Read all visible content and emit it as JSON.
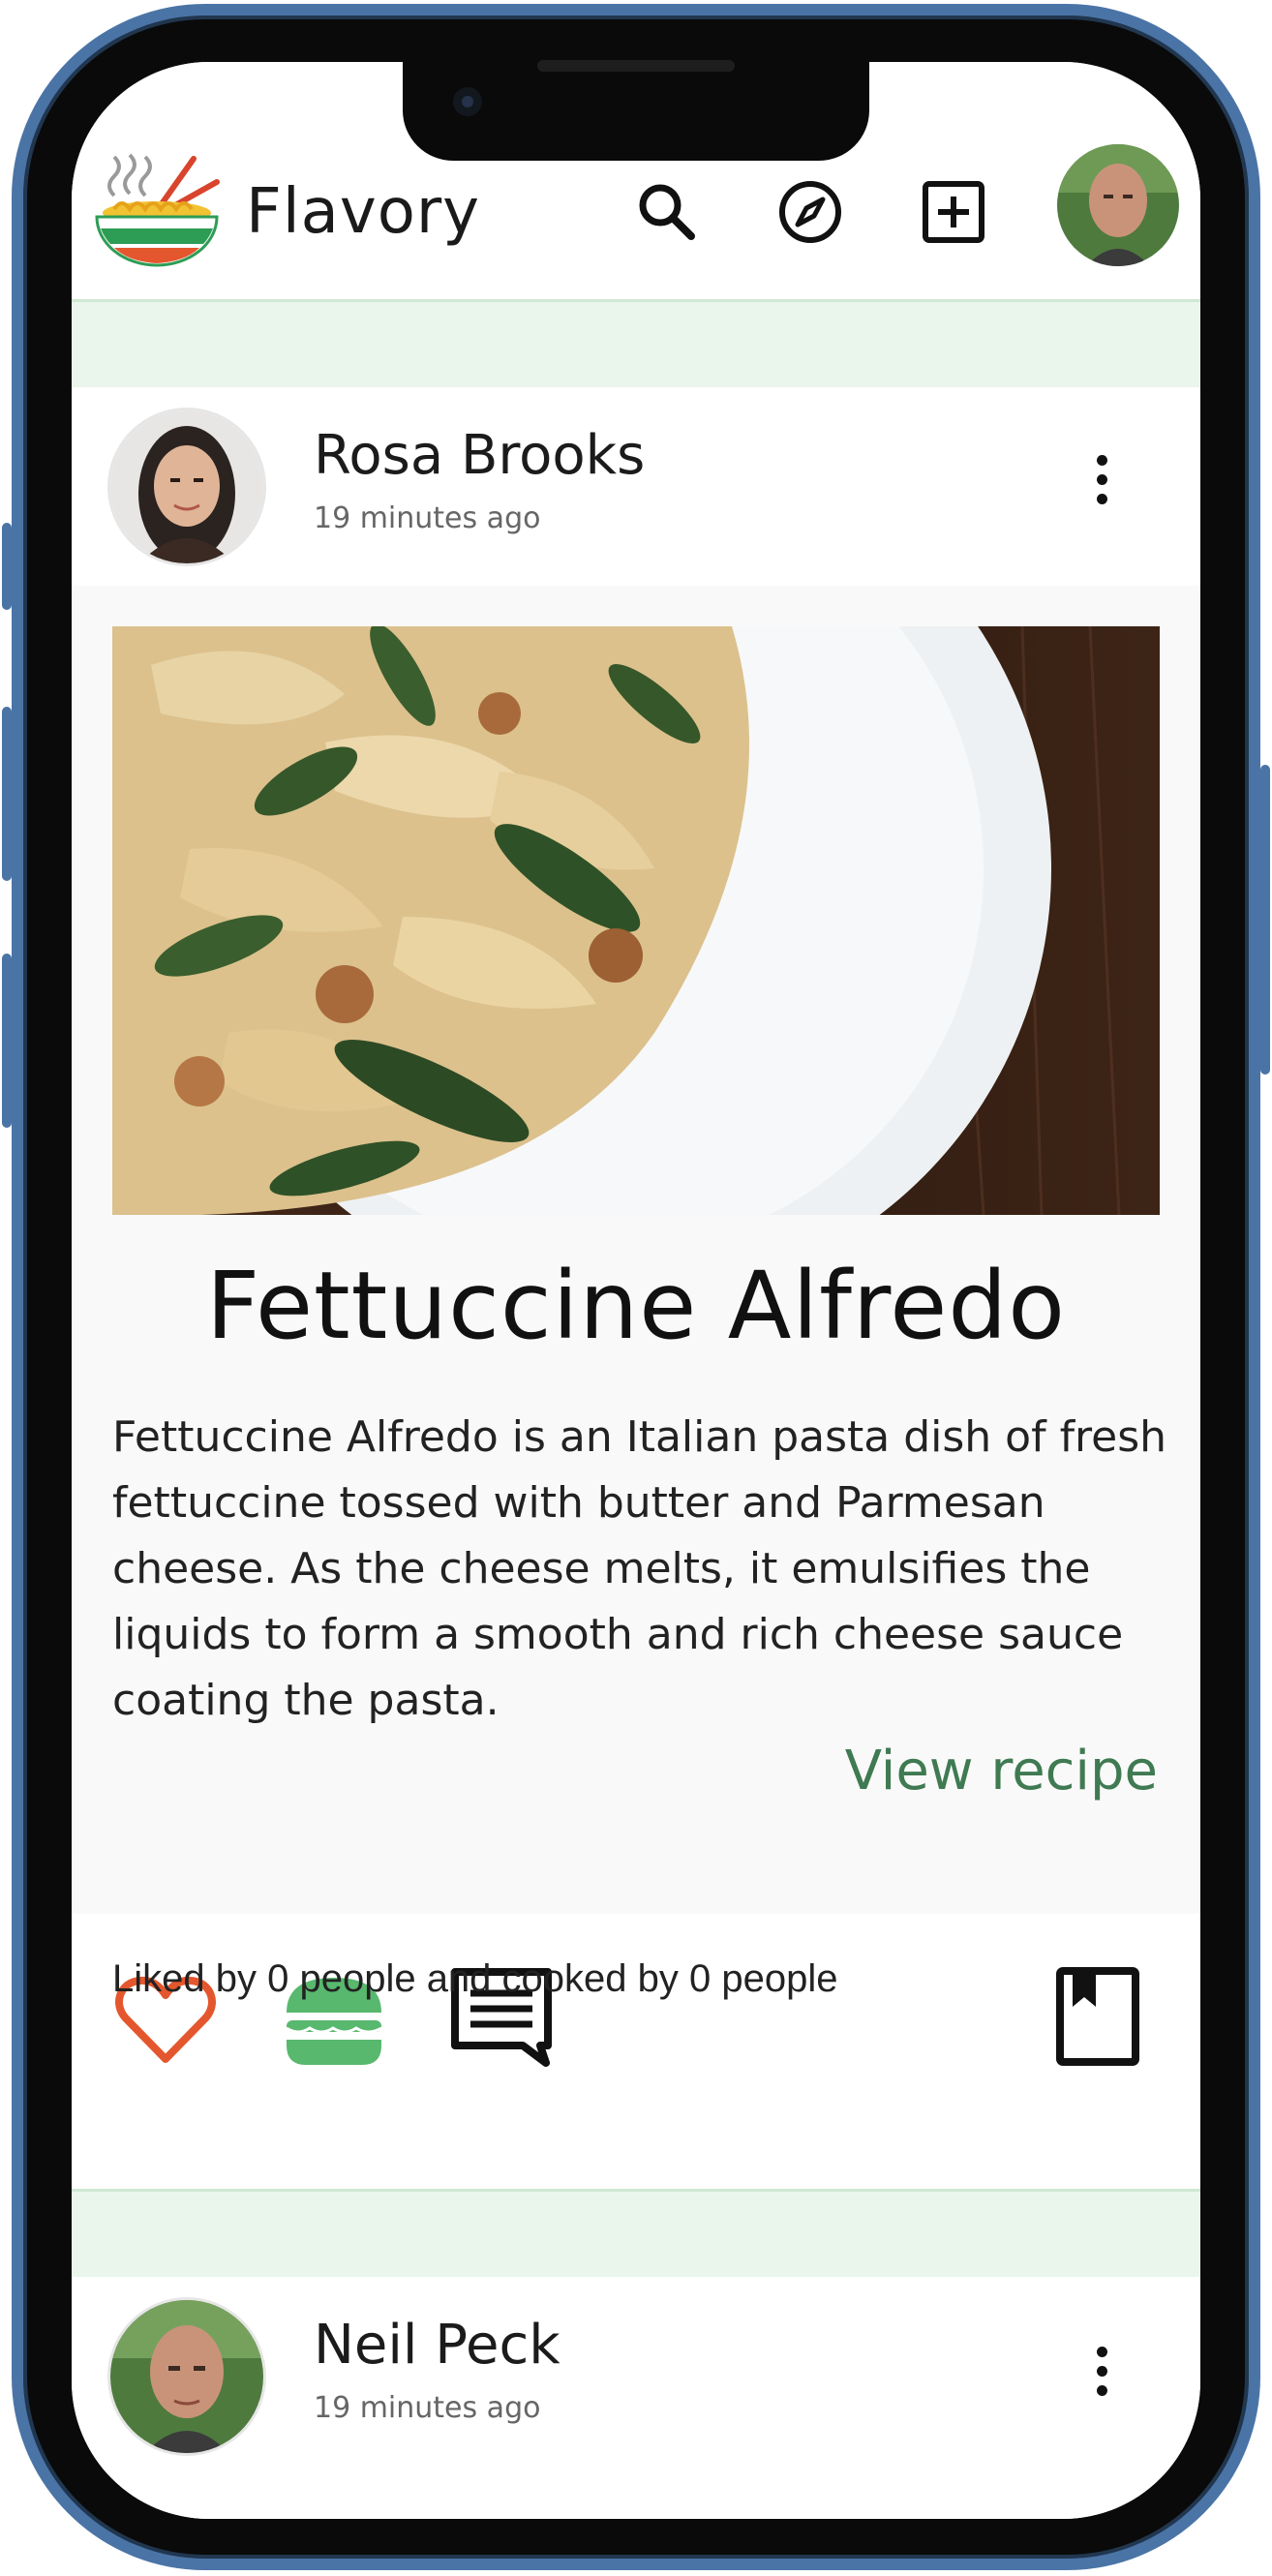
{
  "app": {
    "name": "Flavory",
    "nav_icons": [
      "search-icon",
      "compass-icon",
      "add-square-icon"
    ],
    "colors": {
      "accent_green": "#3f7a52",
      "burger_green": "#58b86e",
      "heart_orange": "#e4572e",
      "band_green": "#eaf6ec"
    }
  },
  "posts": [
    {
      "author": "Rosa Brooks",
      "time": "19 minutes ago",
      "title": "Fettuccine Alfredo",
      "description": "Fettuccine Alfredo is an Italian pasta dish of fresh fettuccine tossed with butter and Parmesan cheese. As the cheese melts, it emulsifies the liquids to form a smooth and rich cheese sauce coating the pasta.",
      "view_recipe_label": "View recipe",
      "stats_text": "Liked by 0 people and cooked by 0 people",
      "actions": [
        "heart-icon",
        "burger-icon",
        "comment-icon",
        "bookmark-icon"
      ]
    },
    {
      "author": "Neil Peck",
      "time": "19 minutes ago"
    }
  ]
}
